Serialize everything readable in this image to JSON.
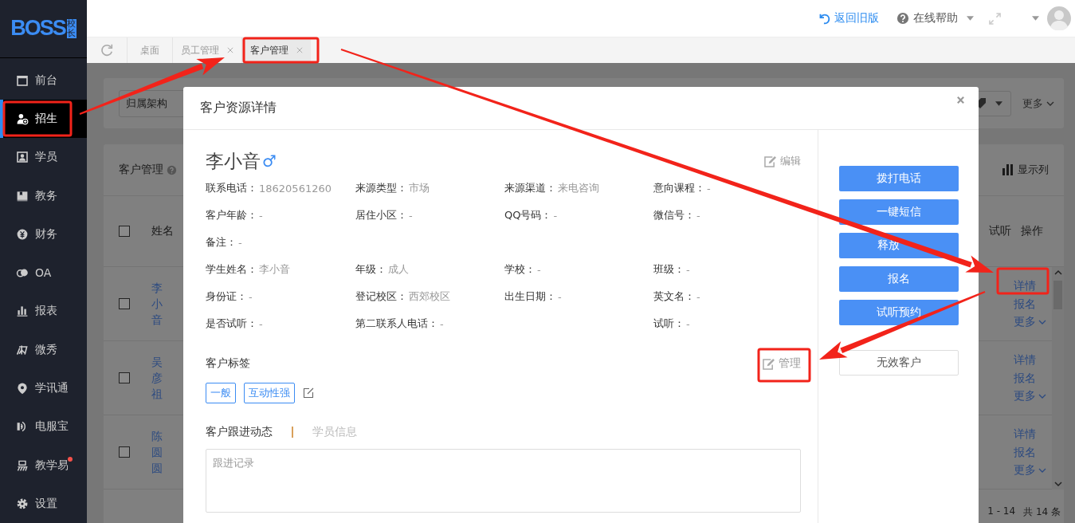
{
  "logo": {
    "text": "BOSS",
    "badge": "校长"
  },
  "sidebar": {
    "items": [
      {
        "label": "前台",
        "selected": false,
        "has_dot": false
      },
      {
        "label": "招生",
        "selected": true,
        "has_dot": false
      },
      {
        "label": "学员",
        "selected": false,
        "has_dot": false
      },
      {
        "label": "教务",
        "selected": false,
        "has_dot": false
      },
      {
        "label": "财务",
        "selected": false,
        "has_dot": false
      },
      {
        "label": "OA",
        "selected": false,
        "has_dot": false
      },
      {
        "label": "报表",
        "selected": false,
        "has_dot": false
      },
      {
        "label": "微秀",
        "selected": false,
        "has_dot": false
      },
      {
        "label": "学讯通",
        "selected": false,
        "has_dot": false
      },
      {
        "label": "电服宝",
        "selected": false,
        "has_dot": false
      },
      {
        "label": "教学易",
        "selected": false,
        "has_dot": true
      },
      {
        "label": "设置",
        "selected": false,
        "has_dot": false
      }
    ]
  },
  "topbar": {
    "back_link": "返回旧版",
    "help": "在线帮助"
  },
  "tabs": [
    {
      "label": "桌面",
      "closable": false,
      "selected": false
    },
    {
      "label": "员工管理",
      "closable": true,
      "selected": false
    },
    {
      "label": "客户管理",
      "closable": true,
      "selected": true
    }
  ],
  "background": {
    "filter": {
      "field": "归属架构",
      "more": "更多"
    },
    "table": {
      "title": "客户管理",
      "show_columns": "显示列",
      "header_checked": false,
      "columns": [
        "姓名",
        "试听",
        "操作"
      ],
      "rows": [
        {
          "checked": false,
          "name": "李小音",
          "actions": [
            "详情",
            "报名",
            "更多"
          ]
        },
        {
          "checked": false,
          "name": "吴彦祖",
          "actions": [
            "详情",
            "报名",
            "更多"
          ]
        },
        {
          "checked": false,
          "name": "陈圆圆",
          "actions": [
            "详情",
            "报名",
            "更多"
          ]
        }
      ],
      "pagination": {
        "range": "1 - 14",
        "total": "共 14 条"
      }
    }
  },
  "modal": {
    "title": "客户资源详情",
    "name": "李小音",
    "gender": "♂",
    "edit": "编辑",
    "info_rows": [
      [
        {
          "label": "联系电话：",
          "value": "18620561260"
        },
        {
          "label": "来源类型：",
          "value": "市场"
        },
        {
          "label": "来源渠道：",
          "value": "来电咨询"
        },
        {
          "label": "意向课程：",
          "value": "-"
        }
      ],
      [
        {
          "label": "客户年龄：",
          "value": "-"
        },
        {
          "label": "居住小区：",
          "value": "-"
        },
        {
          "label": "QQ号码：",
          "value": "-"
        },
        {
          "label": "微信号：",
          "value": "-"
        }
      ],
      [
        {
          "label": "备注：",
          "value": "-"
        }
      ],
      [
        {
          "label": "学生姓名：",
          "value": "李小音"
        },
        {
          "label": "年级：",
          "value": "成人"
        },
        {
          "label": "学校：",
          "value": "-"
        },
        {
          "label": "班级：",
          "value": "-"
        }
      ],
      [
        {
          "label": "身份证：",
          "value": "-"
        },
        {
          "label": "登记校区：",
          "value": "西郊校区"
        },
        {
          "label": "出生日期：",
          "value": "-"
        },
        {
          "label": "英文名：",
          "value": "-"
        }
      ],
      [
        {
          "label": "是否试听：",
          "value": "-"
        },
        {
          "label": "第二联系人电话：",
          "value": "-"
        },
        null,
        {
          "label": "试听：",
          "value": "-"
        }
      ]
    ],
    "tags_title": "客户标签",
    "tags_manage": "管理",
    "tags": [
      "一般",
      "互动性强"
    ],
    "tabs": [
      {
        "label": "客户跟进动态",
        "selected": true
      },
      {
        "label": "学员信息",
        "selected": false
      }
    ],
    "followup_placeholder": "跟进记录",
    "actions": [
      {
        "label": "拨打电话",
        "kind": "primary",
        "cut_off": false
      },
      {
        "label": "一键短信",
        "kind": "primary",
        "cut_off": false
      },
      {
        "label": "释放",
        "kind": "primary",
        "cut_off": true
      },
      {
        "label": "报名",
        "kind": "primary",
        "cut_off": false
      },
      {
        "label": "试听预约",
        "kind": "primary",
        "cut_off": false
      },
      {
        "label": "无效客户",
        "kind": "outline",
        "cut_off": false
      }
    ]
  }
}
